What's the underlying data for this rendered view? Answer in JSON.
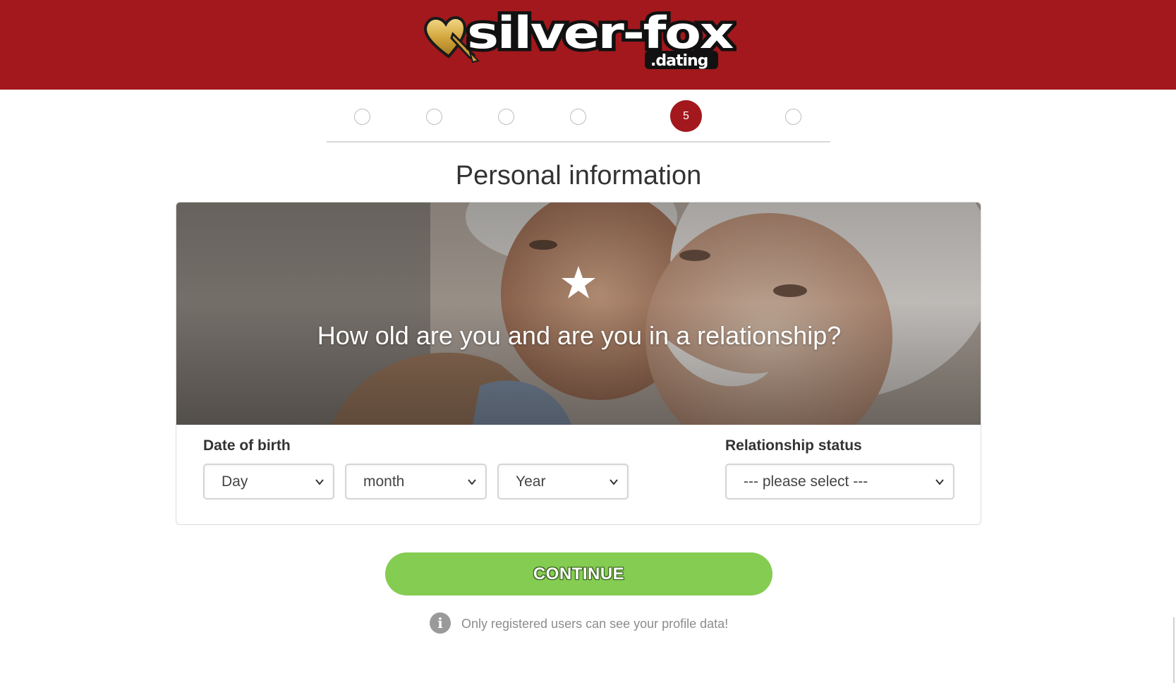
{
  "header": {
    "logo_main": "silver-fox",
    "logo_sub": ".dating",
    "background_color": "#a3181c"
  },
  "progress": {
    "total_steps": 6,
    "current_step": 5,
    "current_step_label": "5"
  },
  "page_title": "Personal information",
  "hero": {
    "icon": "star-icon",
    "question": "How old are you and are you in a relationship?"
  },
  "form": {
    "date_of_birth": {
      "label": "Date of birth",
      "day_value": "Day",
      "month_value": "month",
      "year_value": "Year"
    },
    "relationship_status": {
      "label": "Relationship status",
      "value": "--- please select ---"
    }
  },
  "continue_label": "CONTINUE",
  "privacy_note": {
    "icon": "info-icon",
    "text": "Only registered users can see your profile data!"
  },
  "colors": {
    "accent": "#a3181c",
    "button": "#85cc52"
  }
}
